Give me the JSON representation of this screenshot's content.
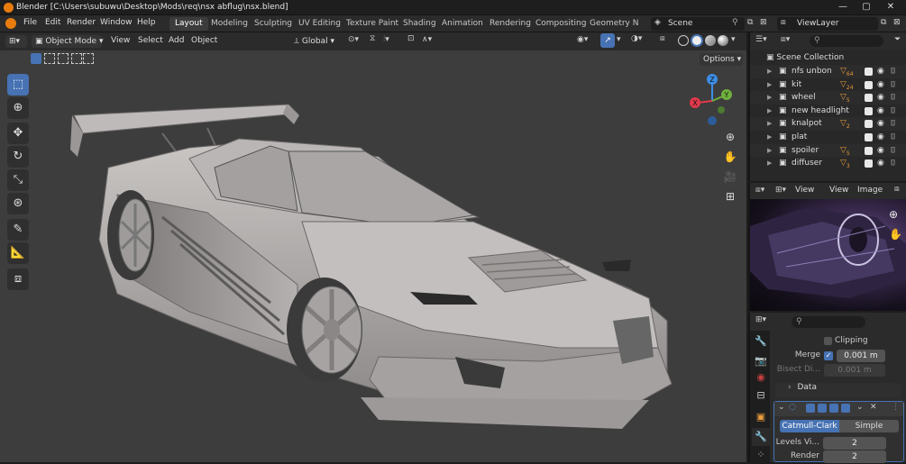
{
  "window": {
    "title": "Blender [C:\\Users\\subuwu\\Desktop\\Mods\\req\\nsx abflug\\nsx.blend]",
    "min": "—",
    "max": "▢",
    "close": "✕"
  },
  "menu": [
    "File",
    "Edit",
    "Render",
    "Window",
    "Help"
  ],
  "workspaces": [
    "Layout",
    "Modeling",
    "Sculpting",
    "UV Editing",
    "Texture Paint",
    "Shading",
    "Animation",
    "Rendering",
    "Compositing",
    "Geometry Noc"
  ],
  "scene": {
    "name": "Scene",
    "view_layer": "ViewLayer"
  },
  "viewport_header": {
    "mode": "Object Mode",
    "menus": [
      "View",
      "Select",
      "Add",
      "Object"
    ],
    "orientation": "Global",
    "options": "Options"
  },
  "gizmo": {
    "x": "X",
    "y": "Y",
    "z": "Z"
  },
  "outliner": {
    "root": "Scene Collection",
    "rows": [
      {
        "name": "nfs unbon",
        "badge": "64"
      },
      {
        "name": "kit",
        "badge": "24"
      },
      {
        "name": "wheel",
        "badge": "5"
      },
      {
        "name": "new headlight",
        "badge": ""
      },
      {
        "name": "knalpot",
        "badge": "2"
      },
      {
        "name": "plat",
        "badge": ""
      },
      {
        "name": "spoiler",
        "badge": "5"
      },
      {
        "name": "diffuser",
        "badge": "3"
      }
    ]
  },
  "image_editor": {
    "menus": [
      "View",
      "View",
      "Image"
    ]
  },
  "properties": {
    "clipping": "Clipping",
    "merge_label": "Merge",
    "merge_value": "0.001 m",
    "bisect_label": "Bisect Di...",
    "bisect_value": "0.001 m",
    "data_label": "Data",
    "subdiv_modes": [
      "Catmull-Clark",
      "Simple"
    ],
    "levels_label": "Levels Vi...",
    "levels_value": "2",
    "render_label": "Render",
    "render_value": "2"
  },
  "colors": {
    "accent": "#4772b3",
    "x_axis": "#e0394b",
    "y_axis": "#6fb03c",
    "z_axis": "#3d8ee6",
    "tri_icon": "#e89b3b"
  }
}
